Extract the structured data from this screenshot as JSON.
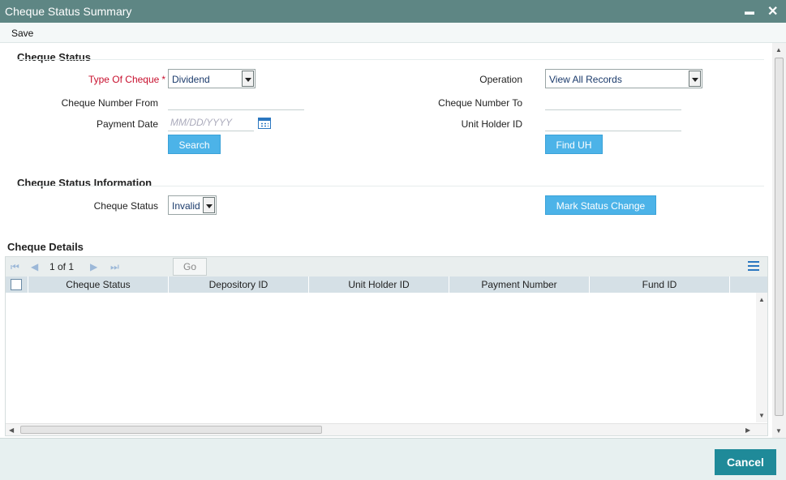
{
  "window": {
    "title": "Cheque Status Summary",
    "minimize_glyph": "▬",
    "close_glyph": "✕"
  },
  "menu": {
    "save": "Save"
  },
  "cheque_status": {
    "heading": "Cheque Status",
    "type_of_cheque_label": "Type Of Cheque",
    "required_mark": "*",
    "type_of_cheque_value": "Dividend",
    "operation_label": "Operation",
    "operation_value": "View All Records",
    "cheque_number_from_label": "Cheque Number From",
    "cheque_number_to_label": "Cheque Number To",
    "payment_date_label": "Payment Date",
    "payment_date_placeholder": "MM/DD/YYYY",
    "unit_holder_id_label": "Unit Holder ID",
    "search_button": "Search",
    "find_uh_button": "Find UH"
  },
  "cheque_status_info": {
    "heading": "Cheque Status Information",
    "cheque_status_label": "Cheque Status",
    "cheque_status_value": "Invalid",
    "mark_status_change_button": "Mark Status Change"
  },
  "cheque_details": {
    "heading": "Cheque Details",
    "pager": {
      "page_text": "1 of 1",
      "go": "Go"
    },
    "columns": [
      "Cheque Status",
      "Depository ID",
      "Unit Holder ID",
      "Payment Number",
      "Fund ID"
    ],
    "rows": []
  },
  "footer": {
    "cancel": "Cancel"
  },
  "colors": {
    "titlebar": "#5e8684",
    "button": "#4cb3e8",
    "cancel": "#1f8a99",
    "required": "#c8102e"
  },
  "icons": [
    "calendar-icon",
    "first-page-icon",
    "prev-page-icon",
    "next-page-icon",
    "last-page-icon",
    "column-list-icon"
  ]
}
